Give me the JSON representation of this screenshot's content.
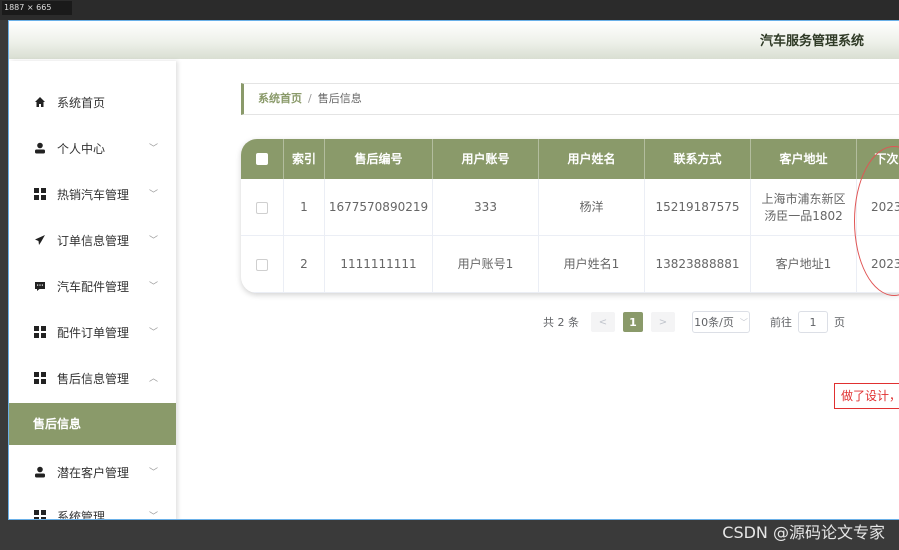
{
  "overlay": {
    "dimensions_label": "1887 × 665"
  },
  "header": {
    "app_title": "汽车服务管理系统"
  },
  "sidebar": {
    "items": [
      {
        "label": "系统首页",
        "icon": "home-icon"
      },
      {
        "label": "个人中心",
        "icon": "user-icon",
        "chevron": "﹀"
      },
      {
        "label": "热销汽车管理",
        "icon": "grid-icon",
        "chevron": "﹀"
      },
      {
        "label": "订单信息管理",
        "icon": "send-icon",
        "chevron": "﹀"
      },
      {
        "label": "汽车配件管理",
        "icon": "message-icon",
        "chevron": "﹀"
      },
      {
        "label": "配件订单管理",
        "icon": "grid-icon",
        "chevron": "﹀"
      },
      {
        "label": "售后信息管理",
        "icon": "grid-icon",
        "chevron": "︿"
      },
      {
        "label": "潜在客户管理",
        "icon": "user-icon",
        "chevron": "﹀"
      },
      {
        "label": "系统管理",
        "icon": "grid-icon",
        "chevron": "﹀"
      }
    ],
    "active_subitem": "售后信息"
  },
  "breadcrumb": {
    "home": "系统首页",
    "separator": "/",
    "current": "售后信息"
  },
  "table": {
    "columns": [
      "索引",
      "售后编号",
      "用户账号",
      "用户姓名",
      "联系方式",
      "客户地址",
      "下次"
    ],
    "rows": [
      {
        "index": "1",
        "after_sale_no": "1677570890219",
        "account": "333",
        "name": "杨洋",
        "phone": "15219187575",
        "address_line1": "上海市浦东新区",
        "address_line2": "汤臣一品1802",
        "next": "2023"
      },
      {
        "index": "2",
        "after_sale_no": "1111111111",
        "account": "用户账号1",
        "name": "用户姓名1",
        "phone": "13823888881",
        "address_line1": "客户地址1",
        "address_line2": "",
        "next": "2023"
      }
    ]
  },
  "pagination": {
    "total": "共 2 条",
    "prev": "<",
    "current": "1",
    "next": ">",
    "page_size": "10条/页",
    "goto_label": "前往",
    "goto_value": "1",
    "page_suffix": "页"
  },
  "annotation": {
    "note": "做了设计，"
  },
  "watermark": "CSDN @源码论文专家",
  "colors": {
    "accent": "#8a9a6a",
    "annotation": "#e03030"
  }
}
